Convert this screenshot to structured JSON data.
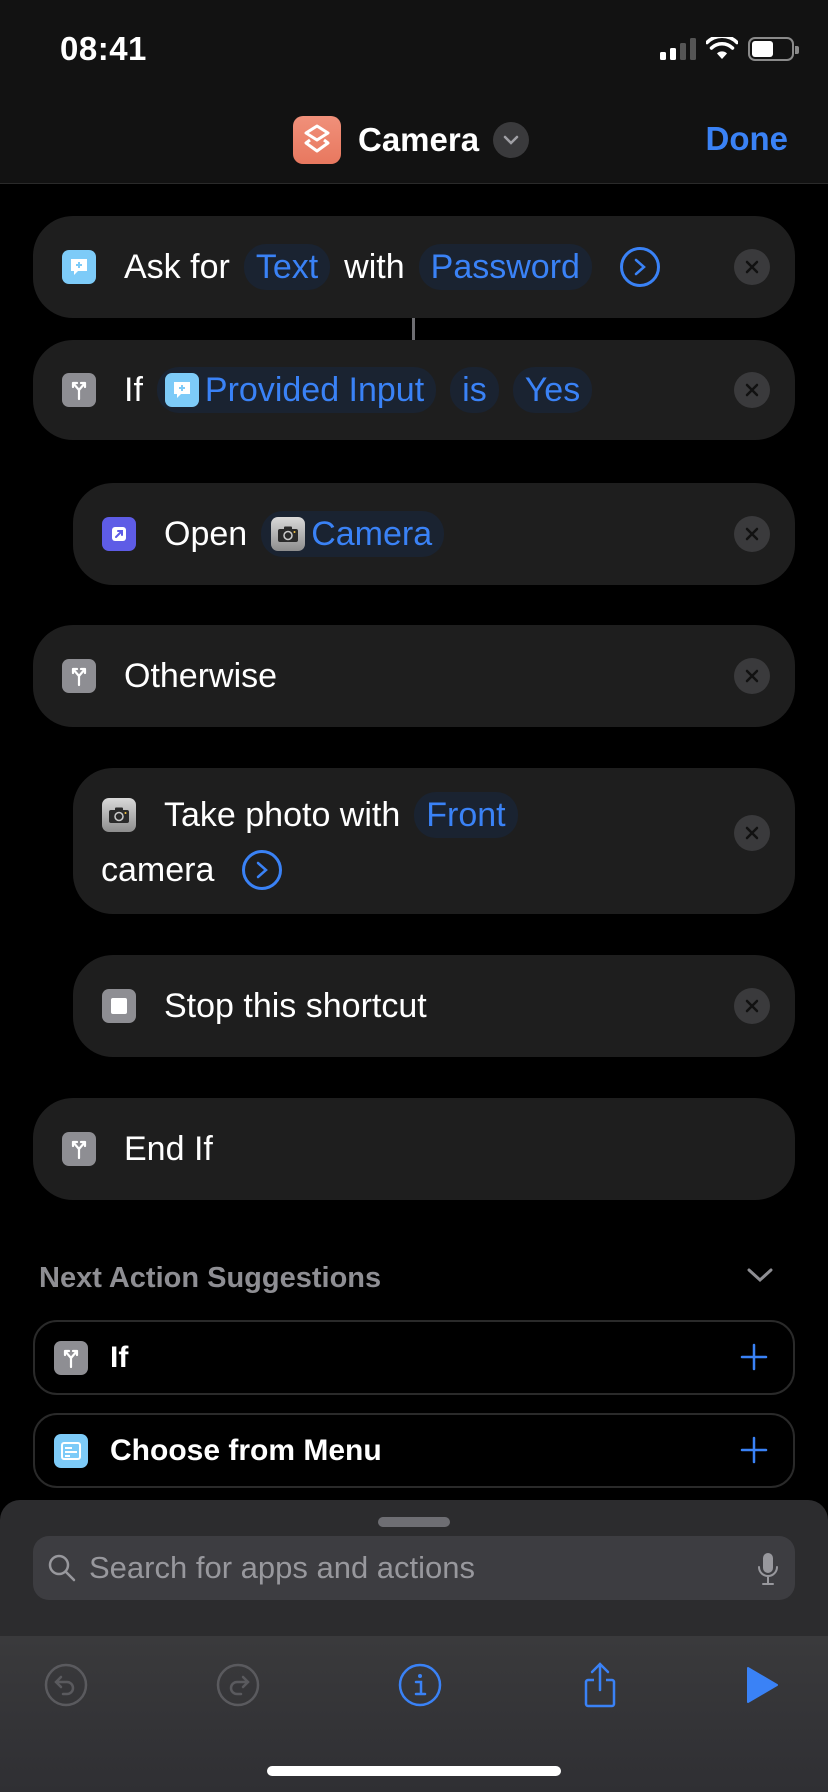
{
  "status_bar": {
    "time": "08:41",
    "signal_bars_active": 2,
    "signal_bars_total": 4,
    "battery_percent": 55
  },
  "nav": {
    "title": "Camera",
    "done_label": "Done",
    "icon": "shortcuts-layers-icon",
    "accent": "#3a82f6",
    "app_icon_color": "#ec8068"
  },
  "actions": [
    {
      "icon": "ask-input-icon",
      "parts": {
        "prefix": "Ask for",
        "token1": "Text",
        "middle": "with",
        "token2": "Password"
      },
      "has_expand": true
    },
    {
      "icon": "if-branch-icon",
      "parts": {
        "prefix": "If",
        "token1": "Provided Input",
        "token1_icon": "ask-input-icon",
        "token2": "is",
        "token3": "Yes"
      }
    },
    {
      "icon": "open-app-icon",
      "parts": {
        "prefix": "Open",
        "token1": "Camera",
        "token1_icon": "camera-app-icon"
      },
      "nested": true
    },
    {
      "icon": "if-branch-icon",
      "parts": {
        "prefix": "Otherwise"
      }
    },
    {
      "icon": "camera-app-icon",
      "parts": {
        "prefix": "Take photo with",
        "token1": "Front",
        "suffix": "camera"
      },
      "has_expand": true,
      "nested": true
    },
    {
      "icon": "stop-icon",
      "parts": {
        "prefix": "Stop this shortcut"
      },
      "nested": true
    },
    {
      "icon": "if-branch-icon",
      "parts": {
        "prefix": "End If"
      }
    }
  ],
  "suggestions": {
    "title": "Next Action Suggestions",
    "items": [
      {
        "label": "If",
        "icon": "if-branch-icon"
      },
      {
        "label": "Choose from Menu",
        "icon": "menu-icon"
      }
    ]
  },
  "search": {
    "placeholder": "Search for apps and actions"
  },
  "toolbar": {
    "items": [
      "undo",
      "redo",
      "info",
      "share",
      "run"
    ]
  }
}
